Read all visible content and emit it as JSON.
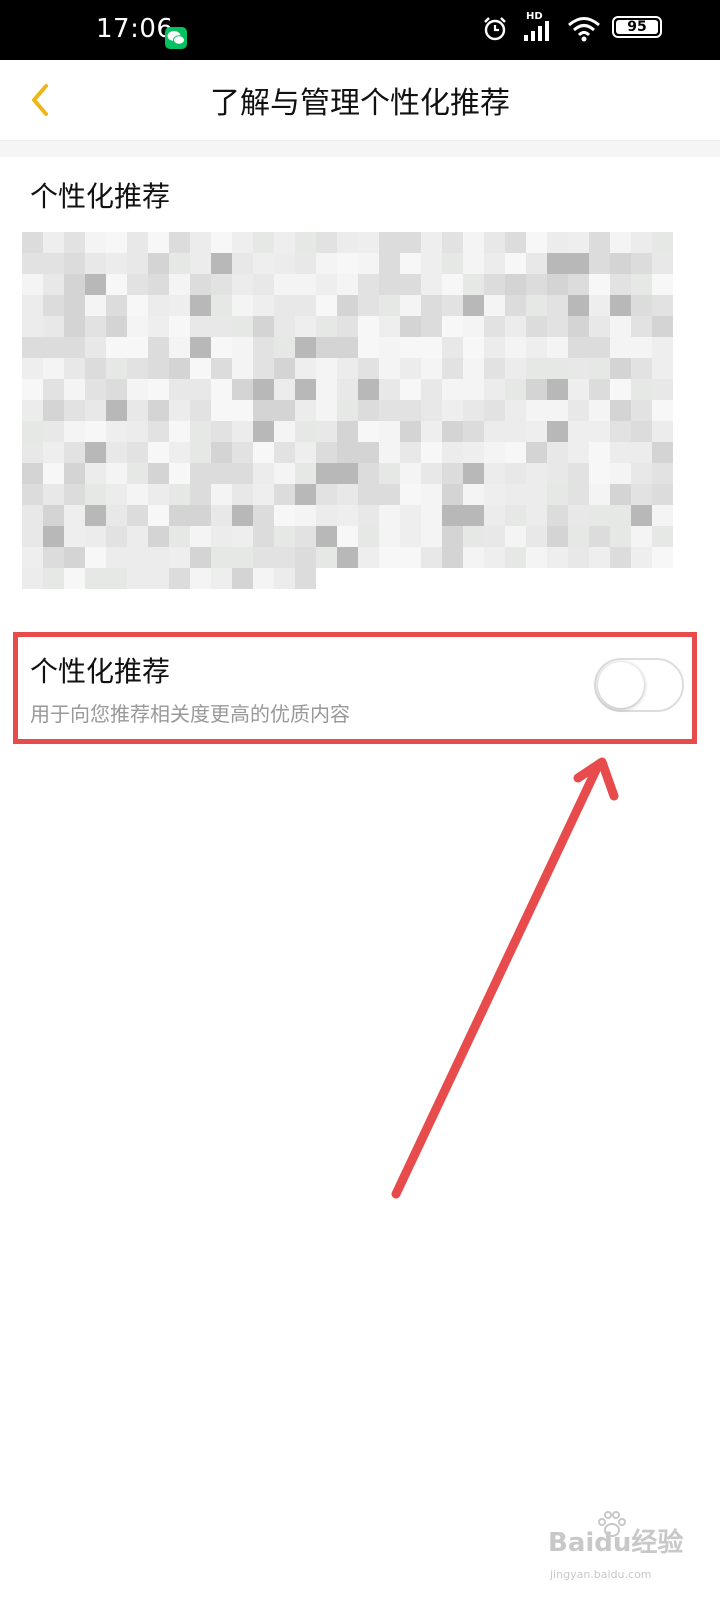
{
  "status_bar": {
    "time": "17:06",
    "network_label": "HD",
    "battery": "95",
    "icons": [
      "wechat-icon",
      "alarm-icon",
      "signal-icon",
      "wifi-icon",
      "battery-icon"
    ]
  },
  "header": {
    "title": "了解与管理个性化推荐",
    "back_icon": "chevron-left-icon",
    "accent_color": "#f0b51a"
  },
  "info_section": {
    "title": "个性化推荐"
  },
  "setting": {
    "title": "个性化推荐",
    "description": "用于向您推荐相关度更高的优质内容",
    "toggle_on": false
  },
  "annotation": {
    "color": "#e84b4b"
  },
  "watermark": {
    "main": "Baidu经验",
    "sub": "jingyan.baidu.com"
  }
}
